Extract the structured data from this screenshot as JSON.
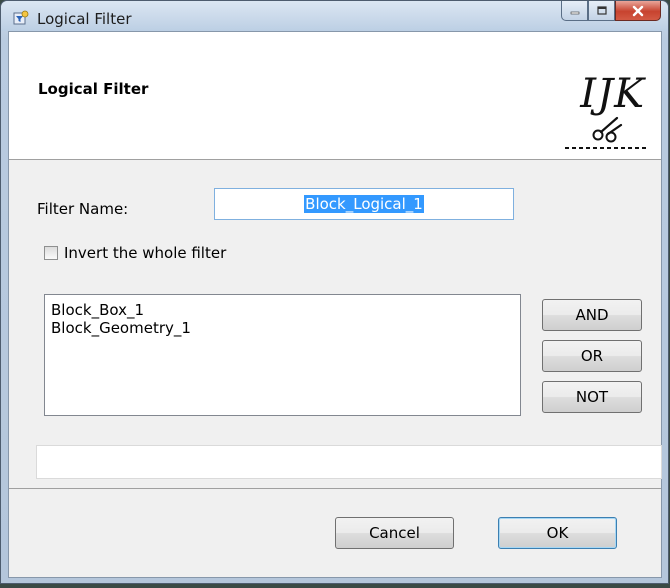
{
  "window": {
    "title": "Logical Filter",
    "icon": "filter-window-icon"
  },
  "banner": {
    "title": "Logical Filter",
    "logo_text": "IJK",
    "logo_icon": "scissors-cut-line-logo"
  },
  "form": {
    "filter_name_label": "Filter Name:",
    "filter_name_value": "Block_Logical_1",
    "invert_label": "Invert the whole filter",
    "invert_checked": false
  },
  "list": {
    "items": [
      "Block_Box_1",
      "Block_Geometry_1"
    ]
  },
  "operators": {
    "and_label": "AND",
    "or_label": "OR",
    "not_label": "NOT"
  },
  "status_text": "",
  "footer": {
    "cancel_label": "Cancel",
    "ok_label": "OK"
  }
}
